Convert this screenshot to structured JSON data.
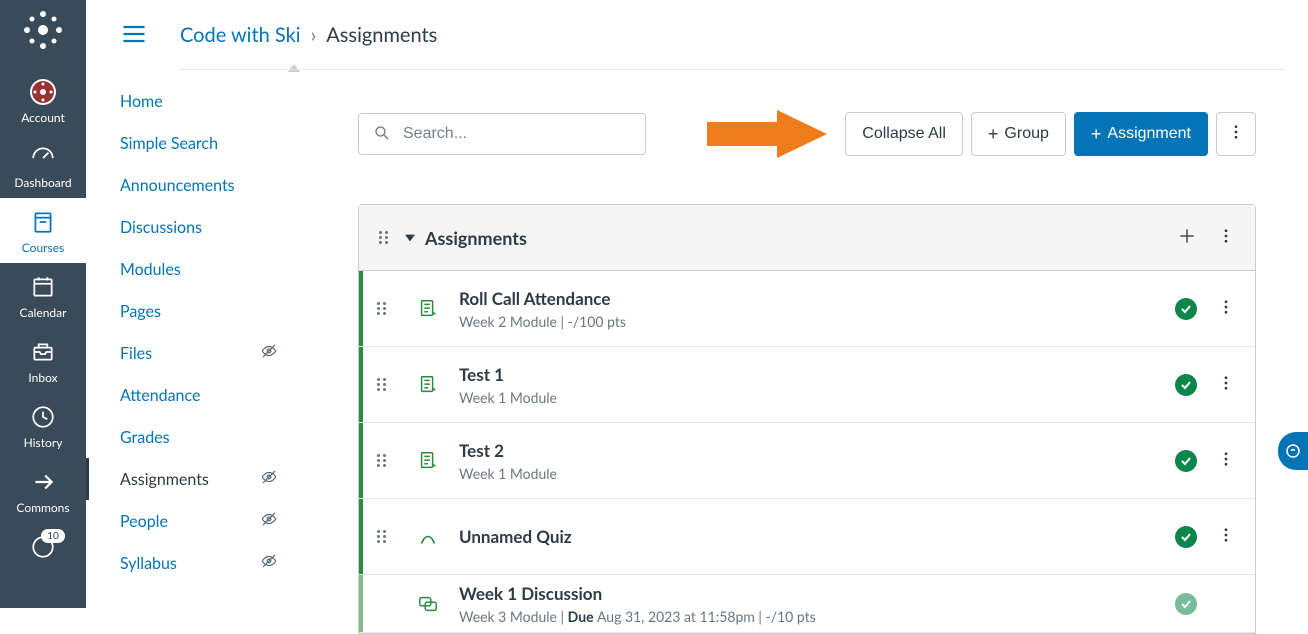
{
  "breadcrumb": {
    "course": "Code with Ski",
    "current": "Assignments"
  },
  "globalNav": [
    {
      "key": "account",
      "label": "Account"
    },
    {
      "key": "dashboard",
      "label": "Dashboard"
    },
    {
      "key": "courses",
      "label": "Courses"
    },
    {
      "key": "calendar",
      "label": "Calendar"
    },
    {
      "key": "inbox",
      "label": "Inbox"
    },
    {
      "key": "history",
      "label": "History"
    },
    {
      "key": "commons",
      "label": "Commons"
    }
  ],
  "notifBadge": "10",
  "courseNav": [
    {
      "label": "Home",
      "hidden": false,
      "active": false
    },
    {
      "label": "Simple Search",
      "hidden": false,
      "active": false
    },
    {
      "label": "Announcements",
      "hidden": false,
      "active": false
    },
    {
      "label": "Discussions",
      "hidden": false,
      "active": false
    },
    {
      "label": "Modules",
      "hidden": false,
      "active": false
    },
    {
      "label": "Pages",
      "hidden": false,
      "active": false
    },
    {
      "label": "Files",
      "hidden": true,
      "active": false
    },
    {
      "label": "Attendance",
      "hidden": false,
      "active": false
    },
    {
      "label": "Grades",
      "hidden": false,
      "active": false
    },
    {
      "label": "Assignments",
      "hidden": true,
      "active": true
    },
    {
      "label": "People",
      "hidden": true,
      "active": false
    },
    {
      "label": "Syllabus",
      "hidden": true,
      "active": false
    }
  ],
  "toolbar": {
    "searchPlaceholder": "Search...",
    "collapseAll": "Collapse All",
    "group": "Group",
    "assignment": "Assignment"
  },
  "group": {
    "title": "Assignments"
  },
  "assignments": [
    {
      "title": "Roll Call Attendance",
      "meta": "Week 2 Module   |   -/100 pts",
      "type": "assignment",
      "published": true
    },
    {
      "title": "Test 1",
      "meta": "Week 1 Module",
      "type": "assignment",
      "published": true
    },
    {
      "title": "Test 2",
      "meta": "Week 1 Module",
      "type": "assignment",
      "published": true
    },
    {
      "title": "Unnamed Quiz",
      "meta": "",
      "type": "quiz",
      "published": true
    },
    {
      "title": "Week 1 Discussion",
      "meta_prefix": "Week 3 Module   |   ",
      "meta_due_label": "Due ",
      "meta_due": "Aug 31, 2023 at 11:58pm",
      "meta_suffix": "   |   -/10 pts",
      "type": "discussion",
      "published": true,
      "dim": true
    }
  ]
}
